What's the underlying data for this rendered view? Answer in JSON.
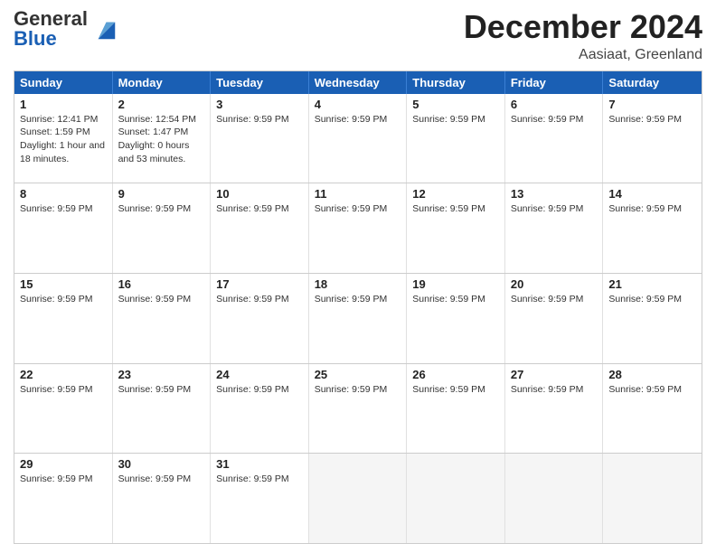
{
  "header": {
    "logo_general": "General",
    "logo_blue": "Blue",
    "title": "December 2024",
    "subtitle": "Aasiaat, Greenland"
  },
  "calendar": {
    "days_of_week": [
      "Sunday",
      "Monday",
      "Tuesday",
      "Wednesday",
      "Thursday",
      "Friday",
      "Saturday"
    ],
    "weeks": [
      [
        {
          "num": "1",
          "info": "Sunrise: 12:41 PM\nSunset: 1:59 PM\nDaylight: 1 hour and 18 minutes.",
          "empty": false
        },
        {
          "num": "2",
          "info": "Sunrise: 12:54 PM\nSunset: 1:47 PM\nDaylight: 0 hours and 53 minutes.",
          "empty": false
        },
        {
          "num": "3",
          "info": "Sunrise: 9:59 PM",
          "empty": false
        },
        {
          "num": "4",
          "info": "Sunrise: 9:59 PM",
          "empty": false
        },
        {
          "num": "5",
          "info": "Sunrise: 9:59 PM",
          "empty": false
        },
        {
          "num": "6",
          "info": "Sunrise: 9:59 PM",
          "empty": false
        },
        {
          "num": "7",
          "info": "Sunrise: 9:59 PM",
          "empty": false
        }
      ],
      [
        {
          "num": "8",
          "info": "Sunrise: 9:59 PM",
          "empty": false
        },
        {
          "num": "9",
          "info": "Sunrise: 9:59 PM",
          "empty": false
        },
        {
          "num": "10",
          "info": "Sunrise: 9:59 PM",
          "empty": false
        },
        {
          "num": "11",
          "info": "Sunrise: 9:59 PM",
          "empty": false
        },
        {
          "num": "12",
          "info": "Sunrise: 9:59 PM",
          "empty": false
        },
        {
          "num": "13",
          "info": "Sunrise: 9:59 PM",
          "empty": false
        },
        {
          "num": "14",
          "info": "Sunrise: 9:59 PM",
          "empty": false
        }
      ],
      [
        {
          "num": "15",
          "info": "Sunrise: 9:59 PM",
          "empty": false
        },
        {
          "num": "16",
          "info": "Sunrise: 9:59 PM",
          "empty": false
        },
        {
          "num": "17",
          "info": "Sunrise: 9:59 PM",
          "empty": false
        },
        {
          "num": "18",
          "info": "Sunrise: 9:59 PM",
          "empty": false
        },
        {
          "num": "19",
          "info": "Sunrise: 9:59 PM",
          "empty": false
        },
        {
          "num": "20",
          "info": "Sunrise: 9:59 PM",
          "empty": false
        },
        {
          "num": "21",
          "info": "Sunrise: 9:59 PM",
          "empty": false
        }
      ],
      [
        {
          "num": "22",
          "info": "Sunrise: 9:59 PM",
          "empty": false
        },
        {
          "num": "23",
          "info": "Sunrise: 9:59 PM",
          "empty": false
        },
        {
          "num": "24",
          "info": "Sunrise: 9:59 PM",
          "empty": false
        },
        {
          "num": "25",
          "info": "Sunrise: 9:59 PM",
          "empty": false
        },
        {
          "num": "26",
          "info": "Sunrise: 9:59 PM",
          "empty": false
        },
        {
          "num": "27",
          "info": "Sunrise: 9:59 PM",
          "empty": false
        },
        {
          "num": "28",
          "info": "Sunrise: 9:59 PM",
          "empty": false
        }
      ],
      [
        {
          "num": "29",
          "info": "Sunrise: 9:59 PM",
          "empty": false
        },
        {
          "num": "30",
          "info": "Sunrise: 9:59 PM",
          "empty": false
        },
        {
          "num": "31",
          "info": "Sunrise: 9:59 PM",
          "empty": false
        },
        {
          "num": "",
          "info": "",
          "empty": true
        },
        {
          "num": "",
          "info": "",
          "empty": true
        },
        {
          "num": "",
          "info": "",
          "empty": true
        },
        {
          "num": "",
          "info": "",
          "empty": true
        }
      ]
    ]
  }
}
